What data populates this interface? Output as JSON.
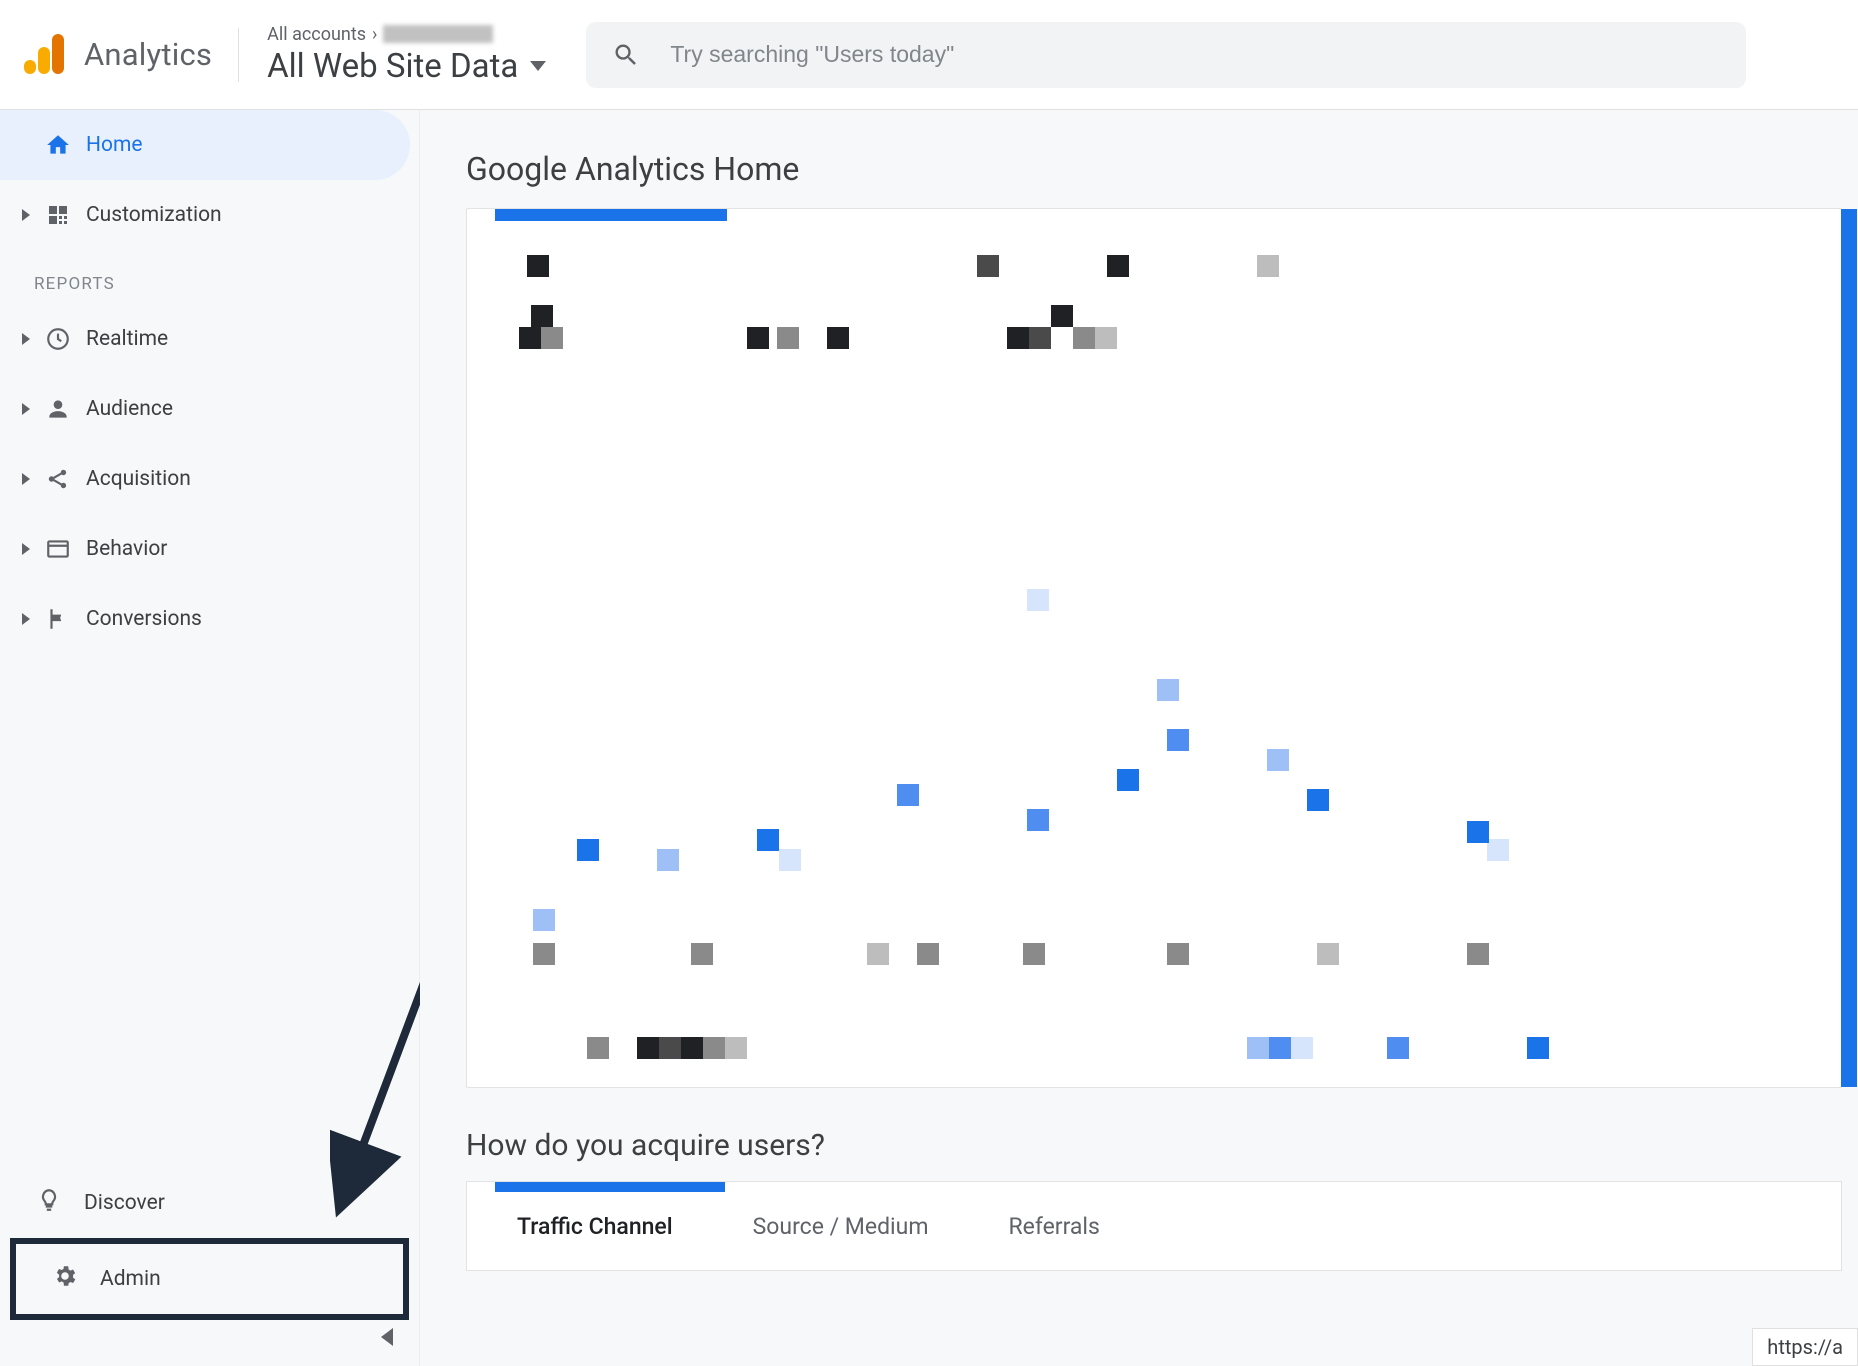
{
  "header": {
    "product": "Analytics",
    "breadcrumb_prefix": "All accounts",
    "breadcrumb_sep": "›",
    "view_name": "All Web Site Data",
    "search_placeholder": "Try searching \"Users today\""
  },
  "sidebar": {
    "items": [
      {
        "label": "Home",
        "icon": "home-icon",
        "active": true
      },
      {
        "label": "Customization",
        "icon": "grid-icon"
      }
    ],
    "reports_label": "REPORTS",
    "reports": [
      {
        "label": "Realtime",
        "icon": "clock-icon"
      },
      {
        "label": "Audience",
        "icon": "person-icon"
      },
      {
        "label": "Acquisition",
        "icon": "share-icon"
      },
      {
        "label": "Behavior",
        "icon": "browser-icon"
      },
      {
        "label": "Conversions",
        "icon": "flag-icon"
      }
    ],
    "discover_label": "Discover",
    "admin_label": "Admin"
  },
  "main": {
    "page_title": "Google Analytics Home",
    "acquire_title": "How do you acquire users?",
    "tabs": [
      {
        "label": "Traffic Channel",
        "active": true
      },
      {
        "label": "Source / Medium"
      },
      {
        "label": "Referrals"
      }
    ]
  },
  "status_url": "https://a"
}
